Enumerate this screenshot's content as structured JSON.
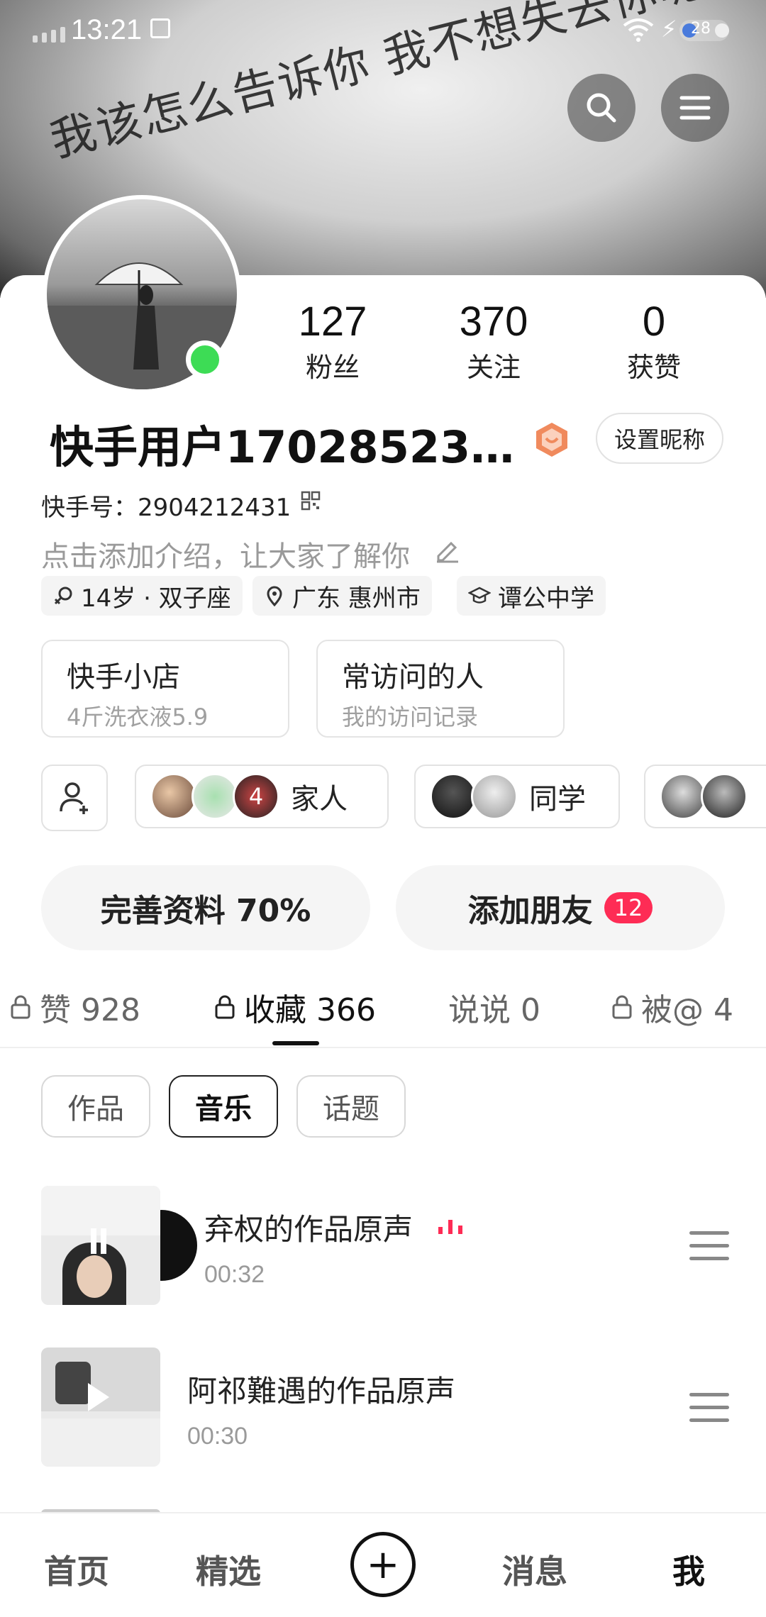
{
  "status_bar": {
    "time": "13:21",
    "battery": "28"
  },
  "banner": {
    "text": "我该怎么告诉你 我不想失去你呢"
  },
  "profile": {
    "stats": [
      {
        "value": "127",
        "label": "粉丝"
      },
      {
        "value": "370",
        "label": "关注"
      },
      {
        "value": "0",
        "label": "获赞"
      }
    ],
    "username": "快手用户17028523…",
    "set_nickname_label": "设置昵称",
    "kuaishou_id": "快手号：2904212431",
    "intro_placeholder": "点击添加介绍，让大家了解你",
    "chips": [
      {
        "icon": "gender-icon",
        "label": "14岁 · 双子座"
      },
      {
        "icon": "location-icon",
        "label": "广东 惠州市"
      },
      {
        "icon": "school-icon",
        "label": "谭公中学"
      }
    ],
    "boxes": [
      {
        "title": "快手小店",
        "subtitle": "4斤洗衣液5.9"
      },
      {
        "title": "常访问的人",
        "subtitle": "我的访问记录"
      }
    ],
    "groups": [
      {
        "label": "家人"
      },
      {
        "label": "同学"
      }
    ],
    "group_avatar_badge": "4",
    "complete_profile_label": "完善资料 70%",
    "add_friends_label": "添加朋友",
    "add_friends_count": "12"
  },
  "tabs": [
    {
      "label": "赞 928",
      "locked": true
    },
    {
      "label": "收藏 366",
      "locked": true,
      "active": true
    },
    {
      "label": "说说 0",
      "locked": false
    },
    {
      "label": "被@ 4",
      "locked": true
    }
  ],
  "subtabs": [
    {
      "label": "作品"
    },
    {
      "label": "音乐",
      "active": true
    },
    {
      "label": "话题"
    }
  ],
  "music": [
    {
      "title": "弃权的作品原声",
      "duration": "00:32"
    },
    {
      "title": "阿祁難遇的作品原声",
      "duration": "00:30"
    }
  ],
  "bottom_nav": [
    {
      "label": "首页"
    },
    {
      "label": "精选"
    },
    {
      "label": "消息"
    },
    {
      "label": "我",
      "active": true
    }
  ],
  "colors": {
    "accent": "#fe2c55",
    "online": "#3ddc55"
  }
}
